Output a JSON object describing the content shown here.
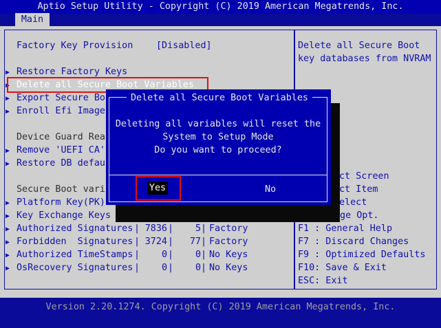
{
  "header": {
    "title": "Aptio Setup Utility - Copyright (C) 2019 American Megatrends, Inc."
  },
  "tabs": [
    {
      "label": "Main"
    }
  ],
  "settings": {
    "factory_key_label": "Factory Key Provision",
    "factory_key_value": "[Disabled]",
    "items": [
      "Restore Factory Keys",
      "Delete all Secure Boot Variables",
      "Export Secure Bo",
      "Enroll Efi Image",
      "Device Guard Rea",
      "Remove 'UEFI CA'",
      "Restore DB defau",
      "Secure Boot vari",
      "Platform Key(PK)",
      "Key Exchange Keys"
    ],
    "db_rows": [
      {
        "name": "Authorized Signatures",
        "size": "7836",
        "count": "5",
        "source": "Factory"
      },
      {
        "name": "Forbidden  Signatures",
        "size": "3724",
        "count": "77",
        "source": "Factory"
      },
      {
        "name": "Authorized TimeStamps",
        "size": "0",
        "count": "0",
        "source": "No Keys"
      },
      {
        "name": "OsRecovery Signatures",
        "size": "0",
        "count": "0",
        "source": "No Keys"
      }
    ]
  },
  "help": {
    "line1": "Delete all Secure Boot",
    "line2": "key databases from NVRAM"
  },
  "keys": [
    "ct Screen",
    "ct Item",
    "elect",
    "nge Opt.",
    "F1 : General Help",
    "F7 : Discard Changes",
    "F9 : Optimized Defaults",
    "F10: Save & Exit",
    "ESC: Exit"
  ],
  "dialog": {
    "title": "Delete all Secure Boot Variables",
    "line1": "Deleting all variables will reset the",
    "line2": "System to Setup Mode",
    "line3": "Do you want to proceed?",
    "yes": "Yes",
    "no": "No"
  },
  "footer": {
    "text": "Version 2.20.1274. Copyright (C) 2019 American Megatrends, Inc."
  },
  "colors": {
    "bios_blue": "#0000b0",
    "panel_gray": "#cfcfcf",
    "highlight_red": "#e01010"
  }
}
